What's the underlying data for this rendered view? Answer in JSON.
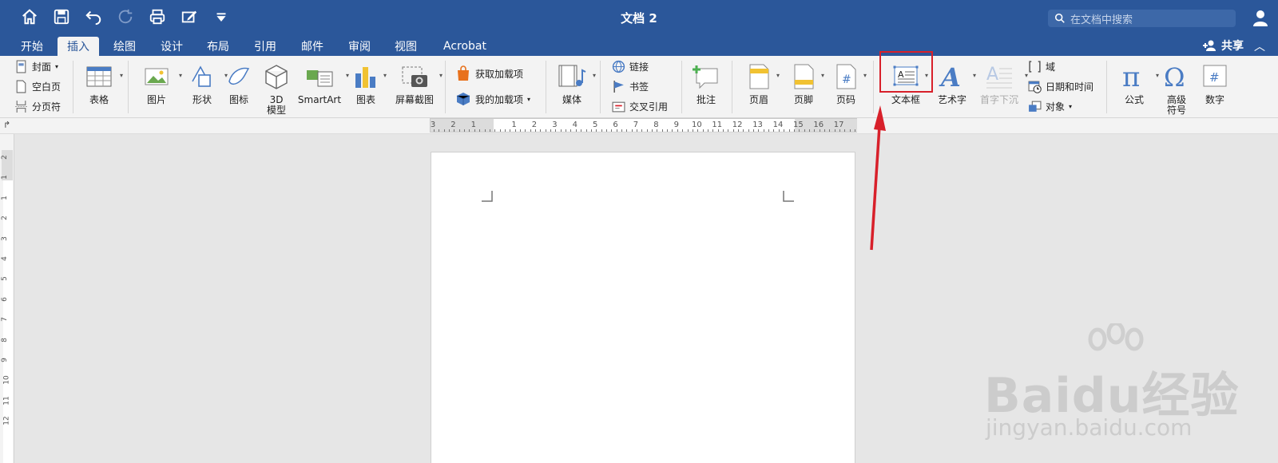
{
  "titlebar": {
    "doc_title": "文档 2",
    "search_placeholder": "在文档中搜索",
    "qat_icons": [
      "home-icon",
      "save-icon",
      "undo-icon",
      "redo-icon",
      "print-icon",
      "edit-icon",
      "customize-icon"
    ]
  },
  "tabs": [
    {
      "label": "开始"
    },
    {
      "label": "插入"
    },
    {
      "label": "绘图"
    },
    {
      "label": "设计"
    },
    {
      "label": "布局"
    },
    {
      "label": "引用"
    },
    {
      "label": "邮件"
    },
    {
      "label": "审阅"
    },
    {
      "label": "视图"
    },
    {
      "label": "Acrobat"
    }
  ],
  "active_tab": "插入",
  "share_label": "共享",
  "ribbon": {
    "pages": {
      "cover": "封面",
      "blank": "空白页",
      "break": "分页符"
    },
    "table": "表格",
    "illustrations": {
      "picture": "图片",
      "shape": "形状",
      "icon": "图标",
      "model3d_line1": "3D",
      "model3d_line2": "模型",
      "smartart": "SmartArt",
      "chart": "图表",
      "screenshot": "屏幕截图"
    },
    "addins": {
      "get": "获取加载项",
      "mine": "我的加载项"
    },
    "media": "媒体",
    "links": {
      "link": "链接",
      "bookmark": "书签",
      "crossref": "交叉引用"
    },
    "comment": "批注",
    "header_footer": {
      "header": "页眉",
      "footer": "页脚",
      "page_number": "页码"
    },
    "text": {
      "textbox": "文本框",
      "wordart": "艺术字",
      "dropcap": "首字下沉",
      "field": "域",
      "datetime": "日期和时间",
      "object": "对象"
    },
    "symbols": {
      "equation": "公式",
      "symbol_line1": "高级",
      "symbol_line2": "符号",
      "number": "数字"
    }
  },
  "ruler": {
    "left_numbers": [
      "3",
      "2",
      "1"
    ],
    "right_numbers": [
      "1",
      "2",
      "3",
      "4",
      "5",
      "6",
      "7",
      "8",
      "9",
      "10",
      "11",
      "12",
      "13",
      "14",
      "15",
      "16",
      "17"
    ]
  },
  "vruler_numbers": [
    "2",
    "1",
    "1",
    "2",
    "3",
    "4",
    "5",
    "6",
    "7",
    "8",
    "9",
    "10",
    "11",
    "12"
  ],
  "watermark": {
    "brand": "Baidu经验",
    "url": "jingyan.baidu.com"
  },
  "colors": {
    "title_blue": "#2b579a",
    "highlight_red": "#d8202a"
  }
}
